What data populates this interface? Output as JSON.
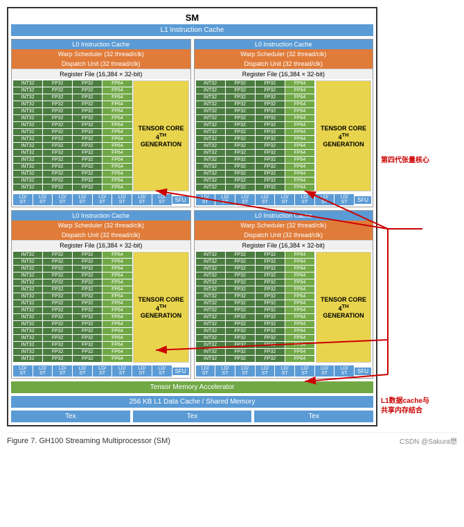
{
  "title": "SM",
  "l1_cache_top": "L1 Instruction Cache",
  "sections": [
    {
      "id": "top",
      "columns": [
        {
          "l0_cache": "L0 Instruction Cache",
          "warp_scheduler": "Warp Scheduler (32 thread/clk)",
          "dispatch_unit": "Dispatch Unit (32 thread/clk)",
          "register_file": "Register File (16,384 × 32-bit)"
        },
        {
          "l0_cache": "L0 Instruction Cache",
          "warp_scheduler": "Warp Scheduler (32 thread/clk)",
          "dispatch_unit": "Dispatch Unit (32 thread/clk)",
          "register_file": "Register File (16,384 × 32-bit)"
        }
      ]
    },
    {
      "id": "bottom",
      "columns": [
        {
          "l0_cache": "L0 Instruction Cache",
          "warp_scheduler": "Warp Scheduler (32 thread/clk)",
          "dispatch_unit": "Dispatch Unit (32 thread/clk)",
          "register_file": "Register File (16,384 × 32-bit)"
        },
        {
          "l0_cache": "L0 Instruction Cache",
          "warp_scheduler": "Warp Scheduler (32 thread/clk)",
          "dispatch_unit": "Dispatch Unit (32 thread/clk)",
          "register_file": "Register File (16,384 × 32-bit)"
        }
      ]
    }
  ],
  "tensor_core_label_line1": "TENSOR CORE",
  "tensor_core_label_line2": "4",
  "tensor_core_label_line3": "GENERATION",
  "reg_rows": [
    [
      "INT32",
      "FP32",
      "FP32",
      "FP64"
    ],
    [
      "INT32",
      "FP32",
      "FP32",
      "FP64"
    ],
    [
      "INT32",
      "FP32",
      "FP32",
      "FP64"
    ],
    [
      "INT32",
      "FP32",
      "FP32",
      "FP64"
    ],
    [
      "INT32",
      "FP32",
      "FP32",
      "FP64"
    ],
    [
      "INT32",
      "FP32",
      "FP32",
      "FP64"
    ],
    [
      "INT32",
      "FP32",
      "FP32",
      "FP64"
    ],
    [
      "INT32",
      "FP32",
      "FP32",
      "FP64"
    ],
    [
      "INT32",
      "FP32",
      "FP32",
      "FP64"
    ],
    [
      "INT32",
      "FP32",
      "FP32",
      "FP64"
    ],
    [
      "INT32",
      "FP32",
      "FP32",
      "FP64"
    ],
    [
      "INT32",
      "FP32",
      "FP32",
      "FP64"
    ],
    [
      "INT32",
      "FP32",
      "FP32",
      "FP64"
    ],
    [
      "INT32",
      "FP32",
      "FP32",
      "FP64"
    ],
    [
      "INT32",
      "FP32",
      "FP32",
      "FP64"
    ],
    [
      "INT32",
      "FP32",
      "FP32",
      "FP64"
    ]
  ],
  "ld_st_labels": [
    "LD/ST",
    "LD/ST",
    "LD/ST",
    "LD/ST",
    "LD/ST",
    "LD/ST",
    "LD/ST",
    "LD/ST"
  ],
  "sfu_label": "SFU",
  "tensor_memory": "Tensor Memory Accelerator",
  "l1_data_cache": "256 KB L1 Data Cache / Shared Memory",
  "tex_labels": [
    "Tex",
    "Tex",
    "Tex"
  ],
  "annotations": {
    "fourth_gen": "第四代张量核心",
    "l1_combined": "L1数据cache与\n共享内存结合"
  },
  "figure_caption": "Figure 7.    GH100 Streaming Multiprocessor (SM)",
  "csdn_credit": "CSDN @Sakura懋"
}
